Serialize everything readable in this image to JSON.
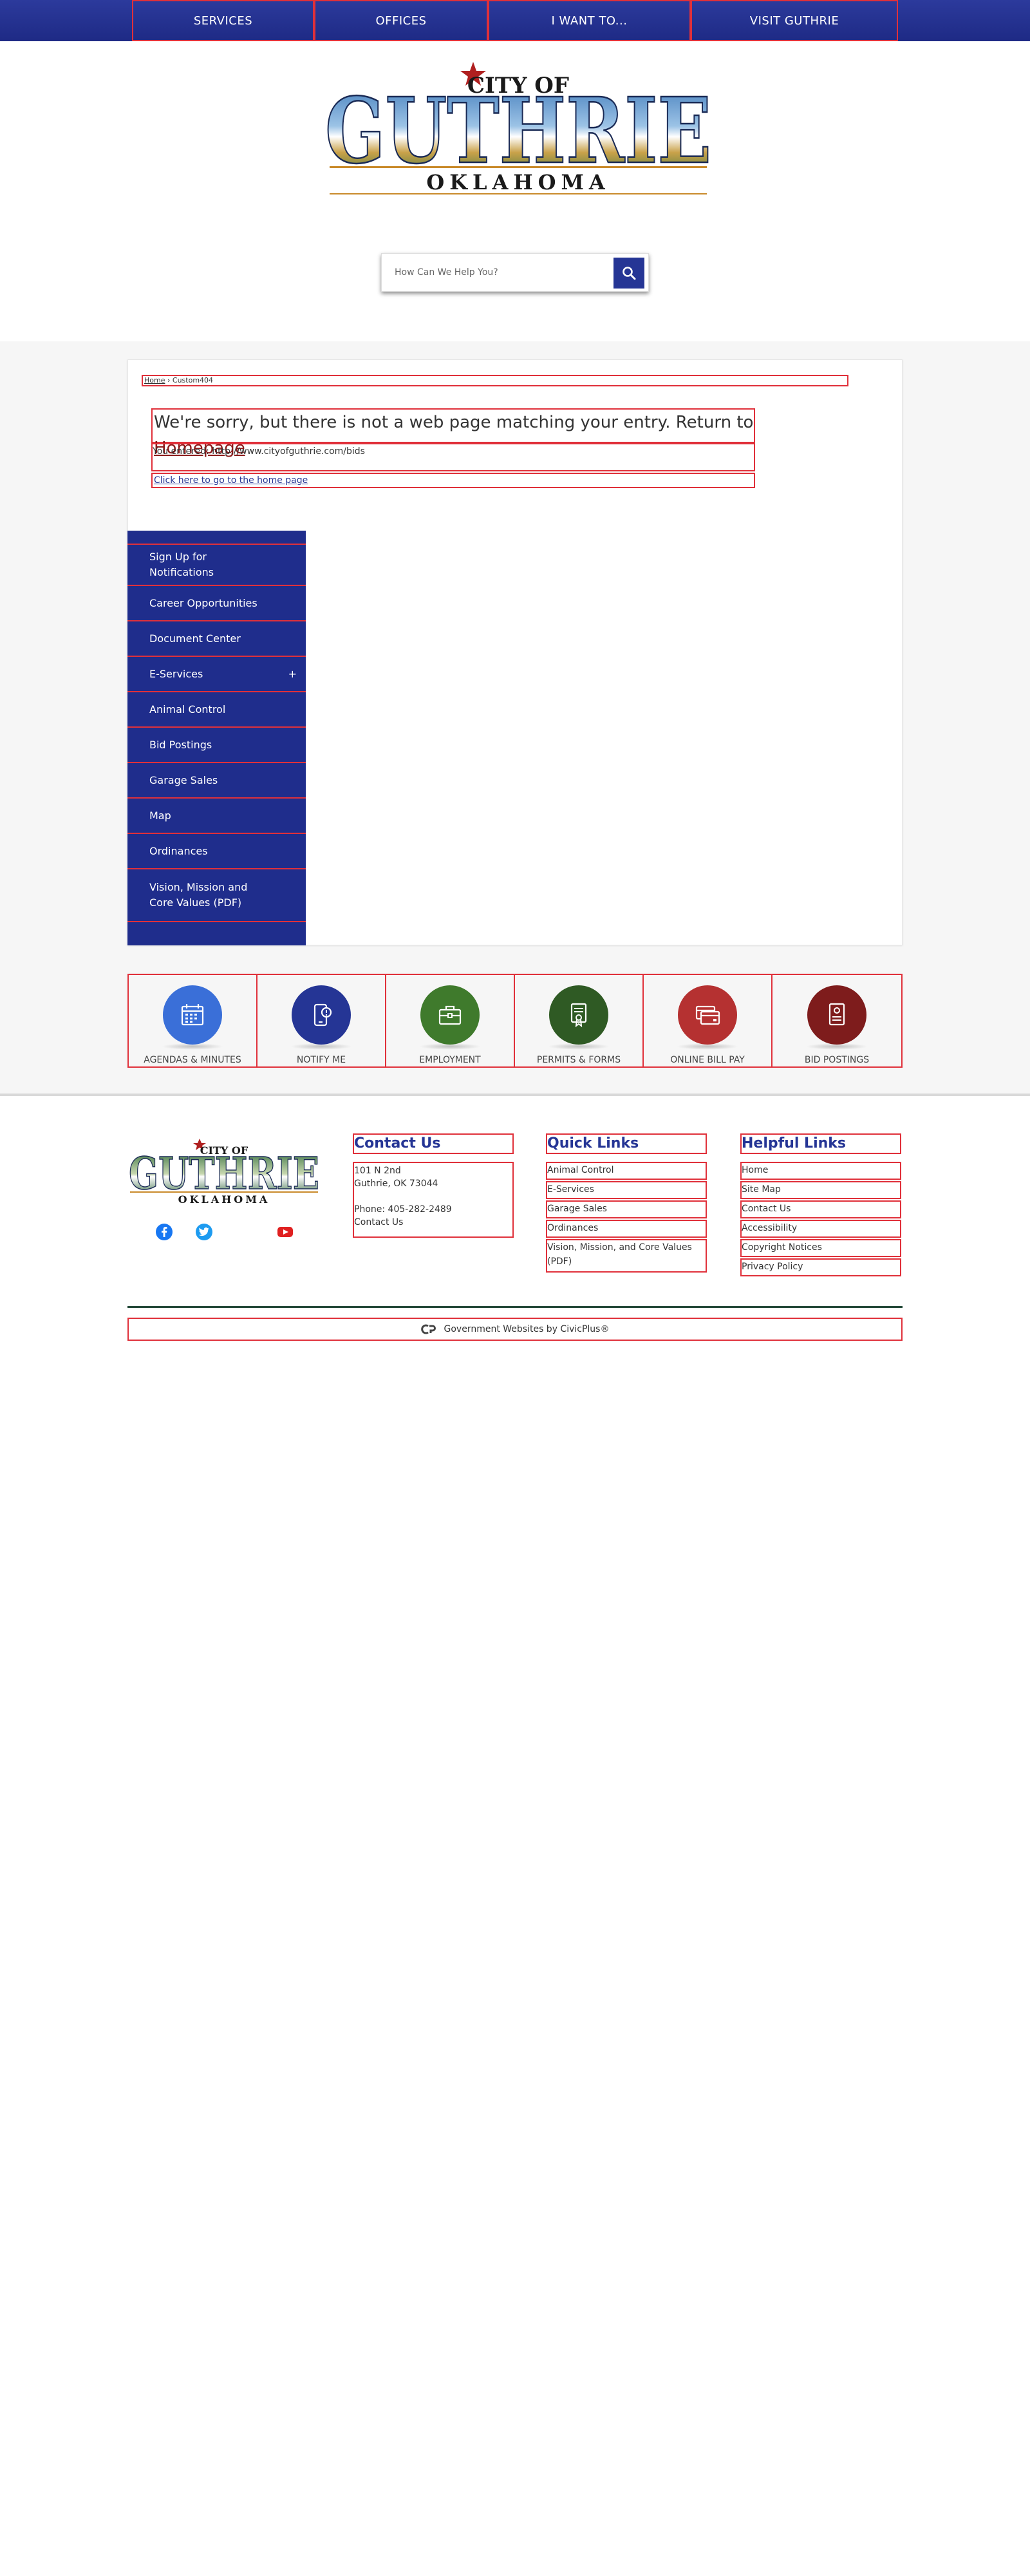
{
  "nav": {
    "items": [
      "SERVICES",
      "OFFICES",
      "I WANT TO...",
      "VISIT GUTHRIE"
    ]
  },
  "logo": {
    "line1": "CITY OF",
    "line2": "GUTHRIE",
    "line3": "OKLAHOMA"
  },
  "search": {
    "placeholder": "How Can We Help You?",
    "button_icon": "search-icon"
  },
  "breadcrumb": {
    "home": "Home",
    "separator": "›",
    "current": "Custom404"
  },
  "error": {
    "message": "We're sorry, but there is not a web page matching your entry. Return to",
    "homepage_link": "Homepage",
    "entered": "You entered: http://www.cityofguthrie.com/bids",
    "click_home": "Click here to go to the home page"
  },
  "sidebar": {
    "items": [
      {
        "label": "Sign Up for Notifications"
      },
      {
        "label": "Career Opportunities"
      },
      {
        "label": "Document Center"
      },
      {
        "label": "E-Services",
        "expander": "+"
      },
      {
        "label": "Animal Control"
      },
      {
        "label": "Bid Postings"
      },
      {
        "label": "Garage Sales"
      },
      {
        "label": "Map"
      },
      {
        "label": "Ordinances"
      },
      {
        "label": "Vision, Mission and Core Values (PDF)"
      }
    ]
  },
  "quick_links": [
    {
      "label": "AGENDAS & MINUTES",
      "icon": "calendar-icon",
      "color": "#3a6fd8"
    },
    {
      "label": "NOTIFY ME",
      "icon": "notification-phone-icon",
      "color": "#253595"
    },
    {
      "label": "EMPLOYMENT",
      "icon": "briefcase-icon",
      "color": "#3f7a2c"
    },
    {
      "label": "PERMITS & FORMS",
      "icon": "permit-document-icon",
      "color": "#2f5a24"
    },
    {
      "label": "ONLINE BILL PAY",
      "icon": "credit-card-icon",
      "color": "#b53131"
    },
    {
      "label": "BID POSTINGS",
      "icon": "bid-document-icon",
      "color": "#7e1c1c"
    }
  ],
  "footer": {
    "contact": {
      "heading": "Contact Us",
      "address1": "101 N 2nd",
      "address2": "Guthrie, OK 73044",
      "phone": "Phone: 405-282-2489",
      "contact_link": "Contact Us"
    },
    "quick": {
      "heading": "Quick Links",
      "items": [
        "Animal Control",
        "E-Services",
        "Garage Sales",
        "Ordinances",
        "Vision, Mission, and Core Values (PDF)"
      ]
    },
    "helpful": {
      "heading": "Helpful Links",
      "items": [
        "Home",
        "Site Map",
        "Contact Us",
        "Accessibility",
        "Copyright Notices",
        "Privacy Policy"
      ]
    },
    "social": [
      {
        "icon": "facebook-icon",
        "color": "#1877f2"
      },
      {
        "icon": "twitter-icon",
        "color": "#1d9bf0"
      },
      {
        "icon": "youtube-icon",
        "color": "#e02020"
      }
    ],
    "civicplus": "Government Websites by CivicPlus®"
  },
  "colors": {
    "nav_blue": "#1e2a85",
    "accent_red": "#8b1a1a",
    "heading_blue": "#253595"
  }
}
